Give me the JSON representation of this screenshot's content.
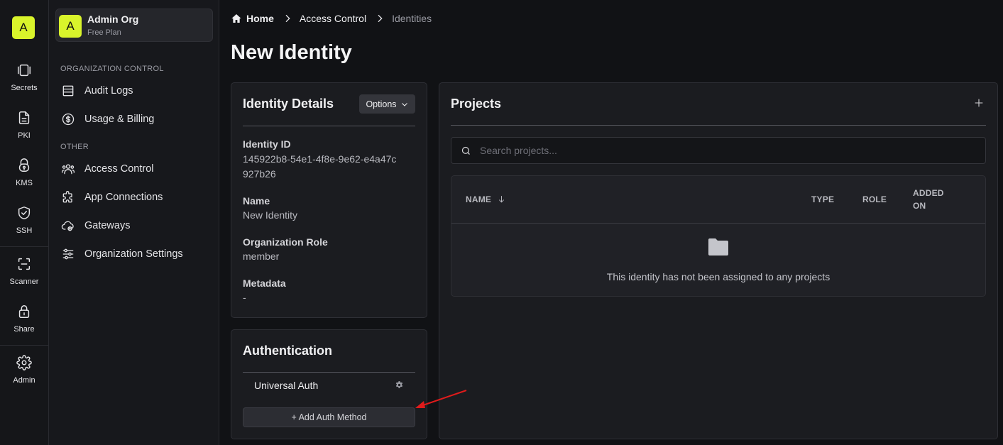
{
  "rail": {
    "logo_letter": "A",
    "items": [
      {
        "label": "Secrets",
        "icon": "secrets-icon"
      },
      {
        "label": "PKI",
        "icon": "document-icon"
      },
      {
        "label": "KMS",
        "icon": "lock-keyhole-icon"
      },
      {
        "label": "SSH",
        "icon": "shield-check-icon"
      },
      {
        "label": "Scanner",
        "icon": "scan-icon"
      },
      {
        "label": "Share",
        "icon": "lock-icon"
      },
      {
        "label": "Admin",
        "icon": "gear-icon"
      }
    ]
  },
  "org": {
    "avatar_letter": "A",
    "name": "Admin Org",
    "plan": "Free Plan"
  },
  "sidebar": {
    "section_org_control": "ORGANIZATION CONTROL",
    "section_other": "OTHER",
    "items": [
      {
        "label": "Audit Logs",
        "icon": "list-icon"
      },
      {
        "label": "Usage & Billing",
        "icon": "dollar-circle-icon"
      },
      {
        "label": "Access Control",
        "icon": "users-icon"
      },
      {
        "label": "App Connections",
        "icon": "puzzle-icon"
      },
      {
        "label": "Gateways",
        "icon": "cloud-icon"
      },
      {
        "label": "Organization Settings",
        "icon": "sliders-icon"
      }
    ]
  },
  "breadcrumb": {
    "home": "Home",
    "access_control": "Access Control",
    "current": "Identities"
  },
  "page_title": "New Identity",
  "identity_details": {
    "title": "Identity Details",
    "options_label": "Options",
    "id_label": "Identity ID",
    "id_value": "145922b8-54e1-4f8e-9e62-e4a47c927b26",
    "name_label": "Name",
    "name_value": "New Identity",
    "role_label": "Organization Role",
    "role_value": "member",
    "metadata_label": "Metadata",
    "metadata_value": "-"
  },
  "authentication": {
    "title": "Authentication",
    "method": "Universal Auth",
    "add_button": "+ Add Auth Method"
  },
  "projects": {
    "title": "Projects",
    "search_placeholder": "Search projects...",
    "columns": {
      "name": "NAME",
      "type": "TYPE",
      "role": "ROLE",
      "added_on_line1": "ADDED",
      "added_on_line2": "ON"
    },
    "empty_message": "This identity has not been assigned to any projects"
  },
  "colors": {
    "accent": "#d9f42b",
    "background": "#111215",
    "card": "#1b1c20",
    "annotation_arrow": "#e01b1b"
  }
}
